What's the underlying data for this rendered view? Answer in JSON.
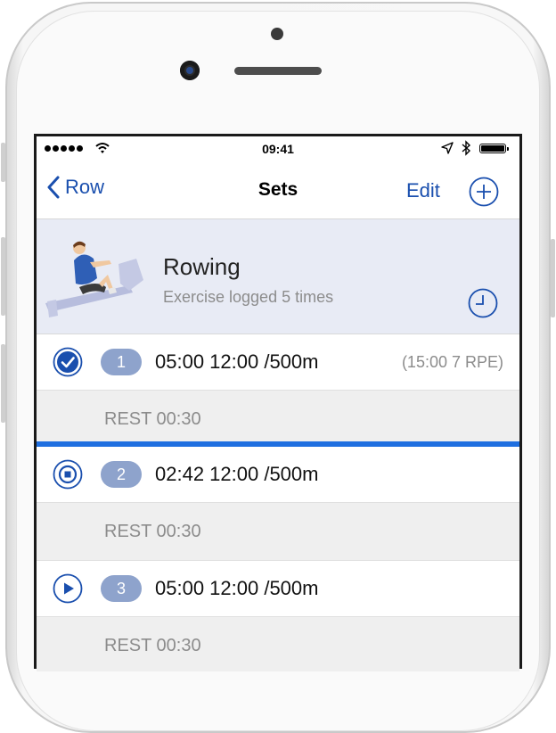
{
  "status_bar": {
    "time": "09:41"
  },
  "nav": {
    "back_label": "Row",
    "title": "Sets",
    "edit_label": "Edit"
  },
  "exercise": {
    "name": "Rowing",
    "subtitle": "Exercise logged 5 times"
  },
  "sets": [
    {
      "number": "1",
      "description": "05:00 12:00 /500m",
      "extra": "(15:00 7 RPE)",
      "status": "completed",
      "rest": "REST 00:30"
    },
    {
      "number": "2",
      "description": "02:42 12:00 /500m",
      "extra": "",
      "status": "in-progress",
      "rest": "REST 00:30"
    },
    {
      "number": "3",
      "description": "05:00 12:00 /500m",
      "extra": "",
      "status": "pending",
      "rest": "REST 00:30"
    }
  ],
  "colors": {
    "accent": "#1a4fae",
    "progress": "#1f6fe0",
    "badge": "#8ea3cc",
    "header_bg": "#e8ebf5"
  },
  "icons": [
    "back-chevron-icon",
    "add-circle-icon",
    "history-clock-icon",
    "check-circle-icon",
    "stop-circle-icon",
    "play-circle-icon"
  ]
}
